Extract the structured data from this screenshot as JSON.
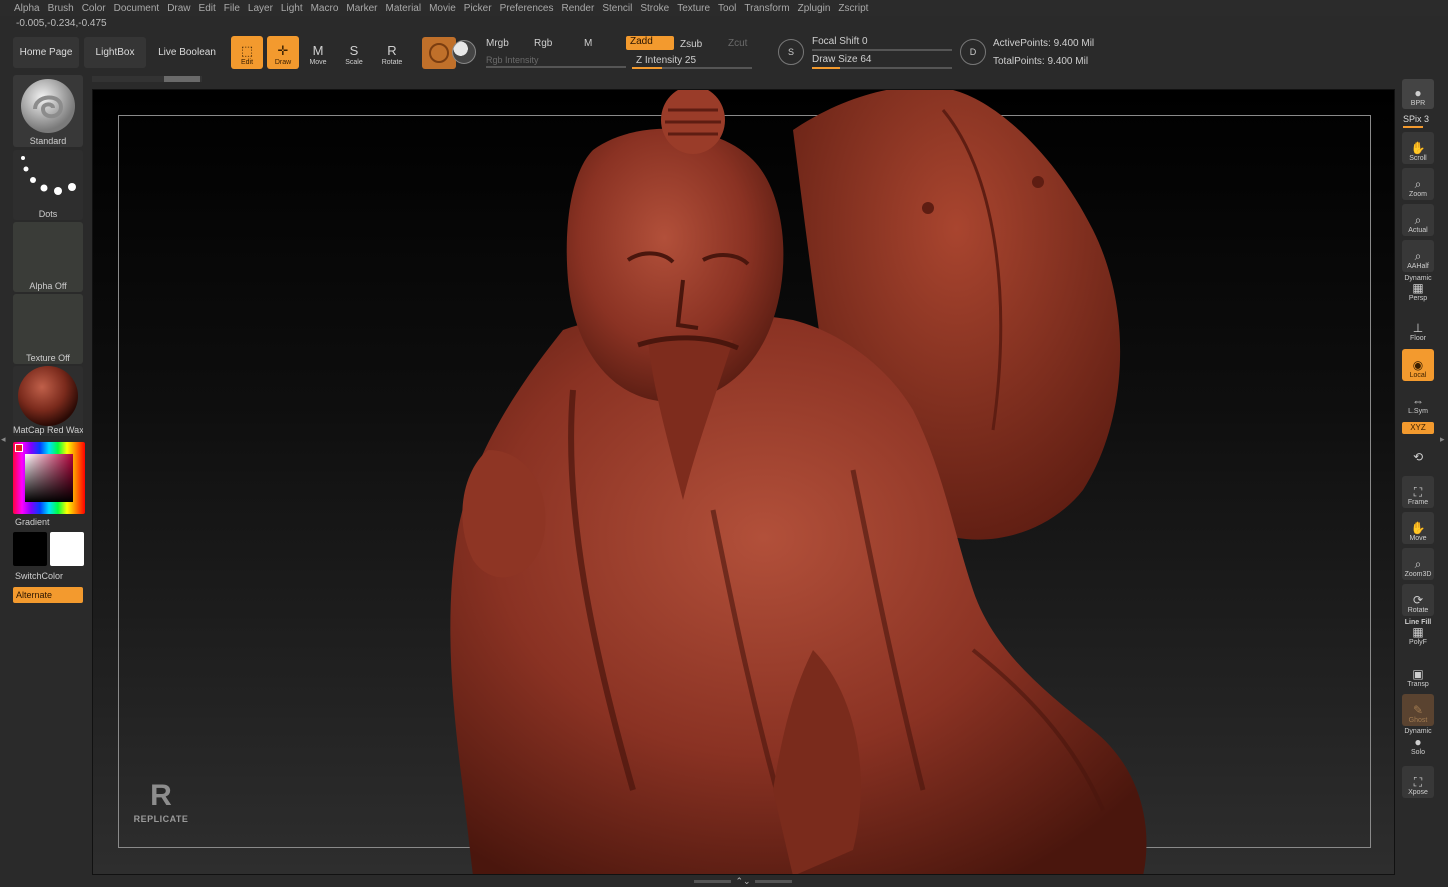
{
  "menu": [
    "Alpha",
    "Brush",
    "Color",
    "Document",
    "Draw",
    "Edit",
    "File",
    "Layer",
    "Light",
    "Macro",
    "Marker",
    "Material",
    "Movie",
    "Picker",
    "Preferences",
    "Render",
    "Stencil",
    "Stroke",
    "Texture",
    "Tool",
    "Transform",
    "Zplugin",
    "Zscript"
  ],
  "coords": "-0.005,-0.234,-0.475",
  "shelf": {
    "home_page": "Home Page",
    "lightbox": "LightBox",
    "live_boolean": "Live Boolean",
    "edit": "Edit",
    "draw": "Draw",
    "move": "Move",
    "scale": "Scale",
    "rotate": "Rotate",
    "move_glyph": "M",
    "scale_glyph": "S",
    "rotate_glyph": "R",
    "mrgb": "Mrgb",
    "rgb": "Rgb",
    "m": "M",
    "rgb_intensity": "Rgb Intensity",
    "zadd": "Zadd",
    "zsub": "Zsub",
    "zcut": "Zcut",
    "z_intensity": "Z Intensity 25",
    "focal_shift": "Focal Shift 0",
    "draw_size": "Draw Size 64",
    "active_points": "ActivePoints: 9.400 Mil",
    "total_points": "TotalPoints: 9.400 Mil",
    "s_icon_letter": "S",
    "d_icon_letter": "D",
    "z_intensity_level": 0.25,
    "draw_size_level": 0.2
  },
  "left": {
    "brush": "Standard",
    "stroke": "Dots",
    "alpha": "Alpha Off",
    "texture": "Texture Off",
    "material": "MatCap Red Wax",
    "gradient": "Gradient",
    "switch_color": "SwitchColor",
    "alternate": "Alternate"
  },
  "canvas": {
    "watermark": "REPLICATE",
    "watermark_mark": "R"
  },
  "right": {
    "bpr": "BPR",
    "spix": "SPix 3",
    "scroll": "Scroll",
    "zoom": "Zoom",
    "actual": "Actual",
    "aahalf": "AAHalf",
    "dynamic": "Dynamic",
    "persp": "Persp",
    "floor": "Floor",
    "local": "Local",
    "lsym": "L.Sym",
    "xyz": "XYZ",
    "frame": "Frame",
    "move": "Move",
    "zoom3d": "Zoom3D",
    "rotate": "Rotate",
    "line_fill": "Line Fill",
    "polyf": "PolyF",
    "transp": "Transp",
    "ghost": "Ghost",
    "dynamic2": "Dynamic",
    "solo": "Solo",
    "xpose": "Xpose"
  },
  "colors": {
    "accent": "#f39a2e",
    "sculpt": "#8a3223",
    "panel": "#2a2a2a"
  }
}
